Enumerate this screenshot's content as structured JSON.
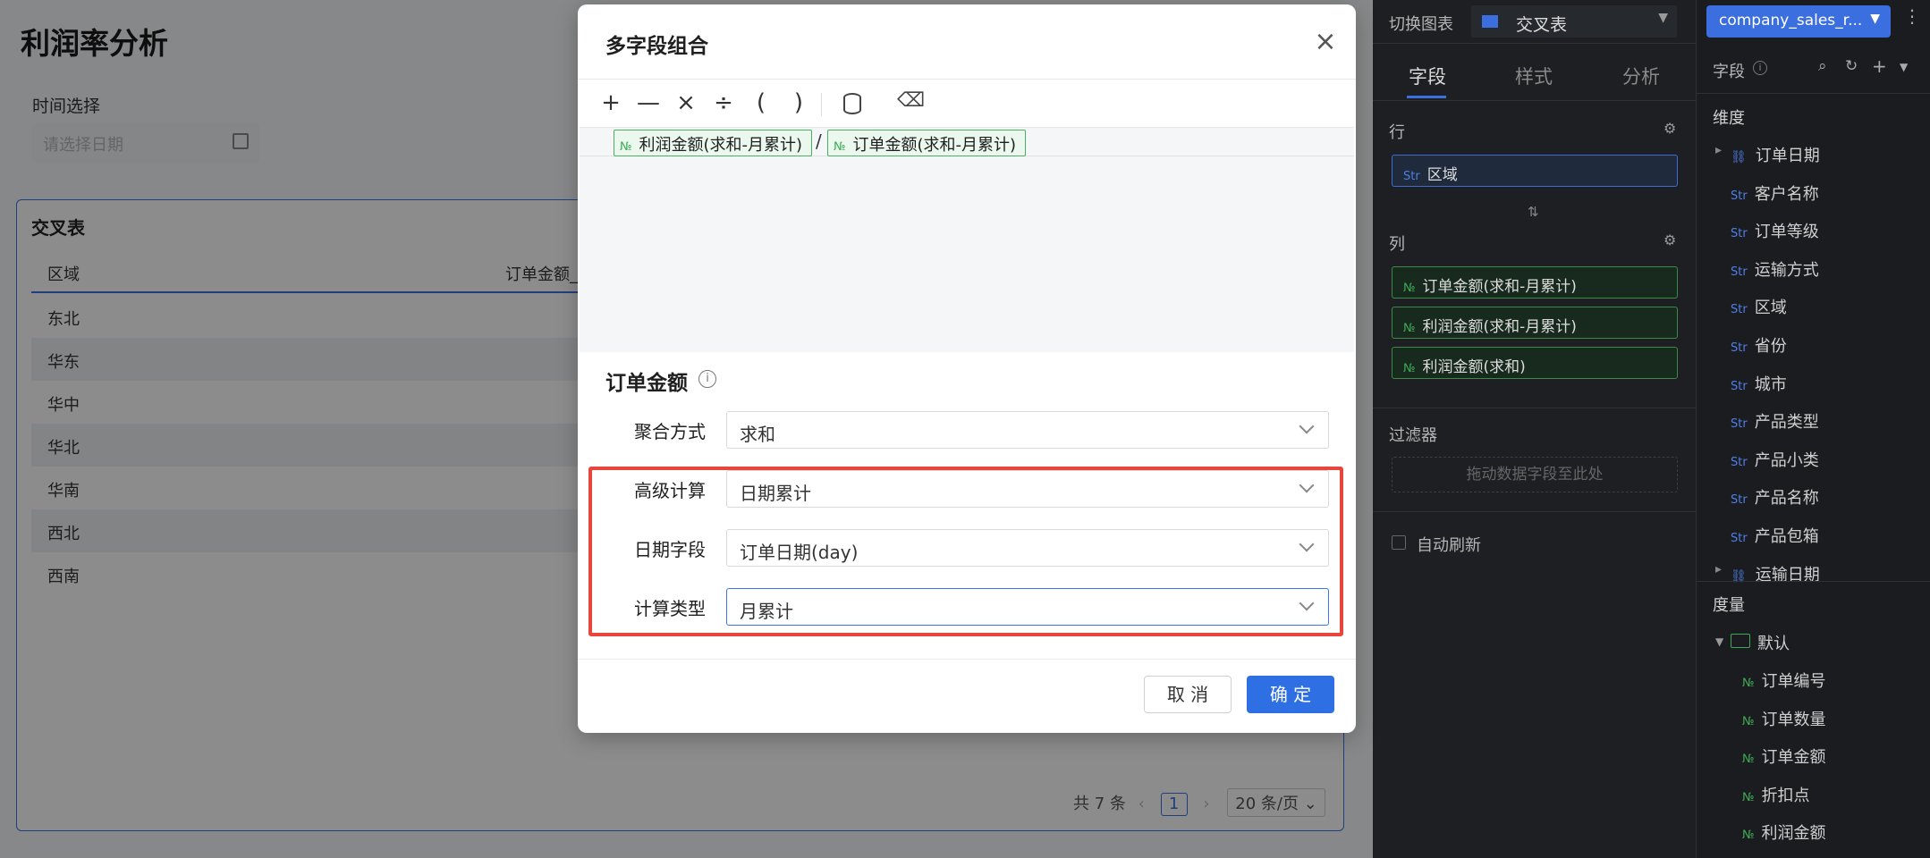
{
  "page": {
    "title": "利润率分析",
    "filter_label": "时间选择",
    "date_placeholder": "请选择日期"
  },
  "table": {
    "title": "交叉表",
    "headers": [
      "区域",
      "订单金额_"
    ],
    "rows": [
      "东北",
      "华东",
      "华中",
      "华北",
      "华南",
      "西北",
      "西南"
    ],
    "pager": {
      "total": "共 7 条",
      "page": "1",
      "page_size": "20 条/页"
    }
  },
  "config_panel": {
    "switch_label": "切换图表",
    "chart_type": "交叉表",
    "tabs": [
      "字段",
      "样式",
      "分析"
    ],
    "rows_label": "行",
    "row_chip": {
      "tag": "Str",
      "label": "区域"
    },
    "cols_label": "列",
    "col_chips": [
      {
        "tag": "№",
        "label": "订单金额(求和-月累计)"
      },
      {
        "tag": "№",
        "label": "利润金额(求和-月累计)"
      },
      {
        "tag": "№",
        "label": "利润金额(求和)"
      }
    ],
    "filter_label": "过滤器",
    "filter_placeholder": "拖动数据字段至此处",
    "auto_refresh": "自动刷新"
  },
  "field_panel": {
    "dataset": "company_sales_r...",
    "fields_label": "字段",
    "dimensions_label": "维度",
    "dimensions": [
      {
        "tag": "",
        "label": "订单日期"
      },
      {
        "tag": "Str",
        "label": "客户名称"
      },
      {
        "tag": "Str",
        "label": "订单等级"
      },
      {
        "tag": "Str",
        "label": "运输方式"
      },
      {
        "tag": "Str",
        "label": "区域"
      },
      {
        "tag": "Str",
        "label": "省份"
      },
      {
        "tag": "Str",
        "label": "城市"
      },
      {
        "tag": "Str",
        "label": "产品类型"
      },
      {
        "tag": "Str",
        "label": "产品小类"
      },
      {
        "tag": "Str",
        "label": "产品名称"
      },
      {
        "tag": "Str",
        "label": "产品包箱"
      },
      {
        "tag": "",
        "label": "运输日期"
      }
    ],
    "measures_label": "度量",
    "measure_group": "默认",
    "measures": [
      {
        "tag": "№",
        "label": "订单编号"
      },
      {
        "tag": "№",
        "label": "订单数量"
      },
      {
        "tag": "№",
        "label": "订单金额"
      },
      {
        "tag": "№",
        "label": "折扣点"
      },
      {
        "tag": "№",
        "label": "利润金额"
      }
    ]
  },
  "modal": {
    "title": "多字段组合",
    "toolbar": [
      "+",
      "—",
      "×",
      "÷",
      "(",
      ")"
    ],
    "formula": {
      "token_a": {
        "tag": "№",
        "label": "利润金额(求和-月累计)"
      },
      "operator": "/",
      "token_b": {
        "tag": "№",
        "label": "订单金额(求和-月累计)"
      }
    },
    "section_title": "订单金额",
    "fields": [
      {
        "label": "聚合方式",
        "value": "求和"
      },
      {
        "label": "高级计算",
        "value": "日期累计"
      },
      {
        "label": "日期字段",
        "value": "订单日期(day)"
      },
      {
        "label": "计算类型",
        "value": "月累计"
      }
    ],
    "cancel": "取 消",
    "ok": "确 定"
  },
  "colors": {
    "accent": "#2f6fe4",
    "highlight": "#e8453c",
    "num_tag": "#3faa55",
    "str_tag": "#4f7ee6"
  }
}
